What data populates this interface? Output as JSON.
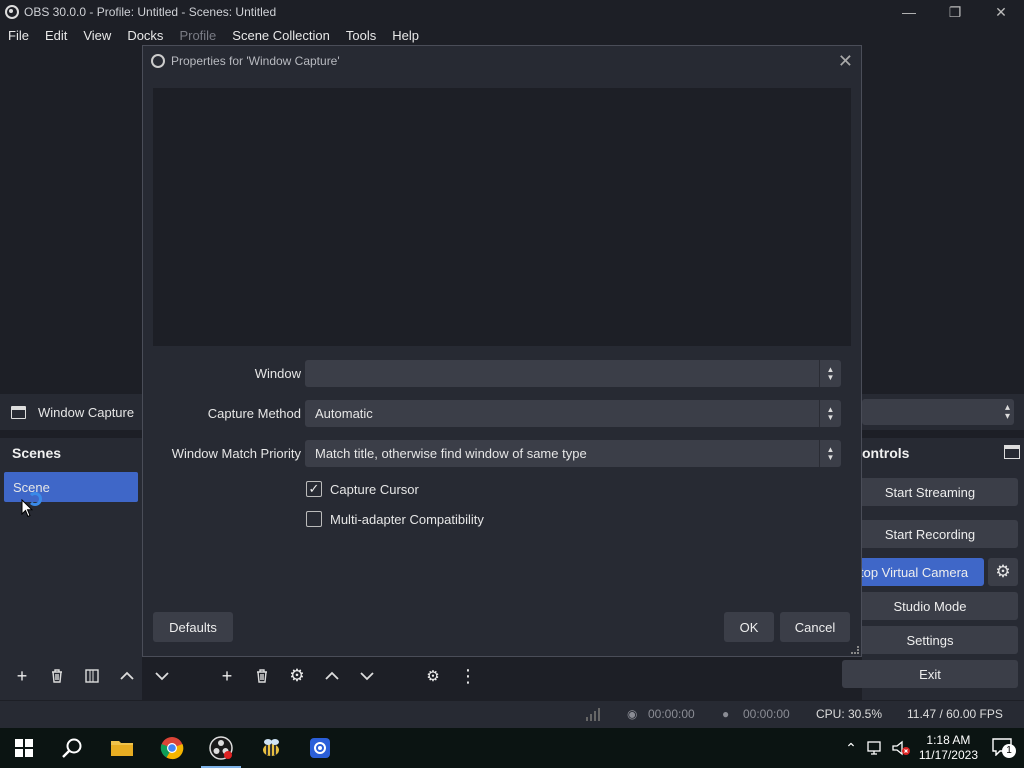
{
  "window": {
    "title": "OBS 30.0.0 - Profile: Untitled - Scenes: Untitled",
    "minimize": "—",
    "maximize": "❐",
    "close": "✕"
  },
  "menu": [
    "File",
    "Edit",
    "View",
    "Docks",
    "Profile",
    "Scene Collection",
    "Tools",
    "Help"
  ],
  "source_bar": {
    "name": "Window Capture"
  },
  "scenes": {
    "header": "Scenes",
    "items": [
      "Scene"
    ]
  },
  "controls": {
    "header": "ontrols",
    "start_streaming": "Start Streaming",
    "start_recording": "Start Recording",
    "virtual_camera": "top Virtual Camera",
    "studio_mode": "Studio Mode",
    "settings": "Settings",
    "exit": "Exit"
  },
  "status": {
    "stream_time": "00:00:00",
    "record_time": "00:00:00",
    "cpu": "CPU: 30.5%",
    "fps": "11.47 / 60.00 FPS"
  },
  "dialog": {
    "title": "Properties for 'Window Capture'",
    "window_label": "Window",
    "window_value": "",
    "capture_method_label": "Capture Method",
    "capture_method_value": "Automatic",
    "match_priority_label": "Window Match Priority",
    "match_priority_value": "Match title, otherwise find window of same type",
    "capture_cursor_label": "Capture Cursor",
    "capture_cursor_checked": true,
    "multi_adapter_label": "Multi-adapter Compatibility",
    "multi_adapter_checked": false,
    "defaults": "Defaults",
    "ok": "OK",
    "cancel": "Cancel"
  },
  "taskbar": {
    "time": "1:18 AM",
    "date": "11/17/2023",
    "notification_count": "1"
  },
  "colors": {
    "accent": "#3f67c8",
    "background": "#1d1f26",
    "panel": "#272a33",
    "control": "#3b3e48"
  }
}
